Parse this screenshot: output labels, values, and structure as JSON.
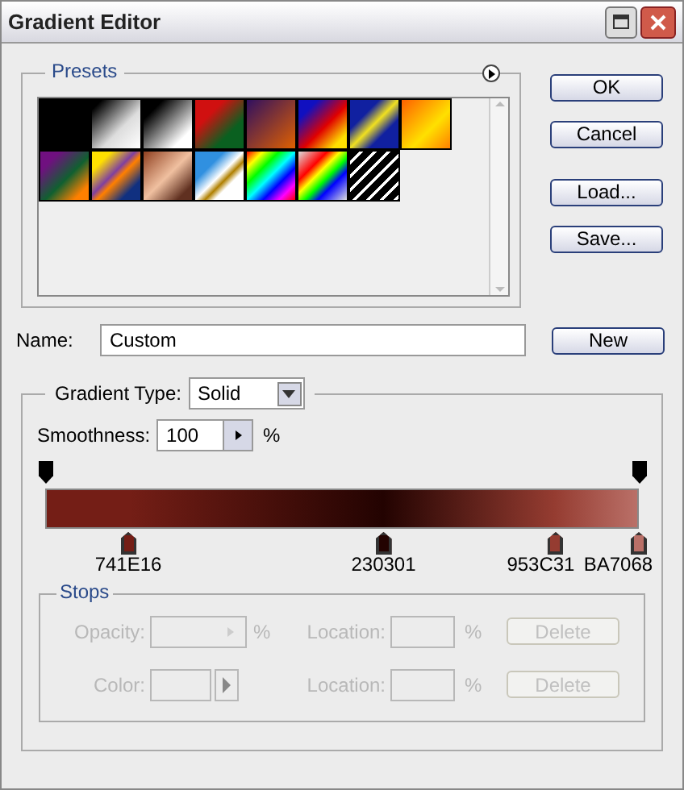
{
  "window": {
    "title": "Gradient Editor"
  },
  "presets": {
    "label": "Presets"
  },
  "buttons": [
    "OK",
    "Cancel",
    "Load...",
    "Save..."
  ],
  "name": {
    "label": "Name:",
    "value": "Custom",
    "button": "New"
  },
  "gradient": {
    "type_label": "Gradient Type:",
    "type_value": "Solid",
    "smoothness_label": "Smoothness:",
    "smoothness_value": "100",
    "smoothness_unit": "%",
    "opacity_stops": [
      {
        "level": 0
      },
      {
        "level": 1
      }
    ],
    "color_stops": [
      {
        "label": "741E16",
        "color": "#741e16",
        "level": 0.14
      },
      {
        "label": "230301",
        "color": "#230301",
        "level": 0.57
      },
      {
        "label": "953C31",
        "color": "#953c31",
        "level": 0.86
      },
      {
        "label": "BA7068",
        "color": "#ba7068",
        "level": 1
      }
    ]
  },
  "stops": {
    "label": "Stops",
    "rows": [
      {
        "label": "Opacity:",
        "kind": "opacity",
        "unit": "%",
        "location_label": "Location:",
        "location_unit": "%",
        "delete": "Delete",
        "disabled": true
      },
      {
        "label": "Color:",
        "kind": "color",
        "location_label": "Location:",
        "location_unit": "%",
        "delete": "Delete",
        "disabled": true
      }
    ]
  }
}
